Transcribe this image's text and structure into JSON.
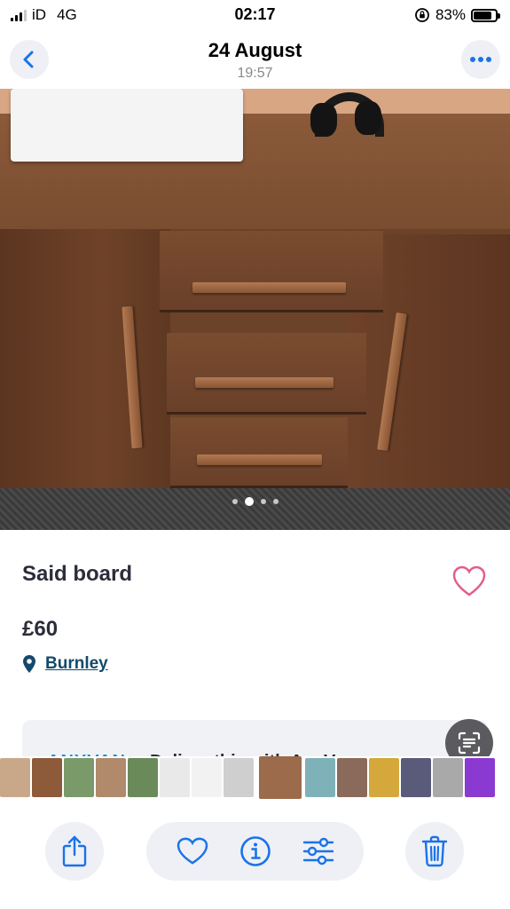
{
  "status_bar": {
    "carrier": "iD",
    "network": "4G",
    "time": "02:17",
    "battery_percent": "83%",
    "battery_level": 0.83,
    "icons": [
      "signal-icon",
      "orientation-lock-icon",
      "battery-icon"
    ]
  },
  "header": {
    "title": "24 August",
    "subtitle": "19:57",
    "back_icon": "chevron-left-icon",
    "more_icon": "ellipsis-icon"
  },
  "photo": {
    "page_count": 4,
    "active_page": 1
  },
  "listing": {
    "title": "Said board",
    "price": "£60",
    "location": "Burnley",
    "favorite_icon": "heart-outline-icon",
    "location_icon": "map-pin-icon"
  },
  "promo": {
    "logo": "ANYVAN",
    "text": "Deliver this with AnyVan"
  },
  "thumbnail_strip": {
    "count": 15,
    "selected_index": 8
  },
  "toolbar": {
    "items": [
      {
        "icon": "share-icon"
      },
      {
        "icon": "heart-icon"
      },
      {
        "icon": "info-icon"
      },
      {
        "icon": "adjust-sliders-icon"
      },
      {
        "icon": "trash-icon"
      }
    ]
  },
  "colors": {
    "accent": "#1a73e8",
    "heart_pink": "#e45c8f",
    "location_text": "#134a6b",
    "button_bg": "#eef0f5"
  }
}
